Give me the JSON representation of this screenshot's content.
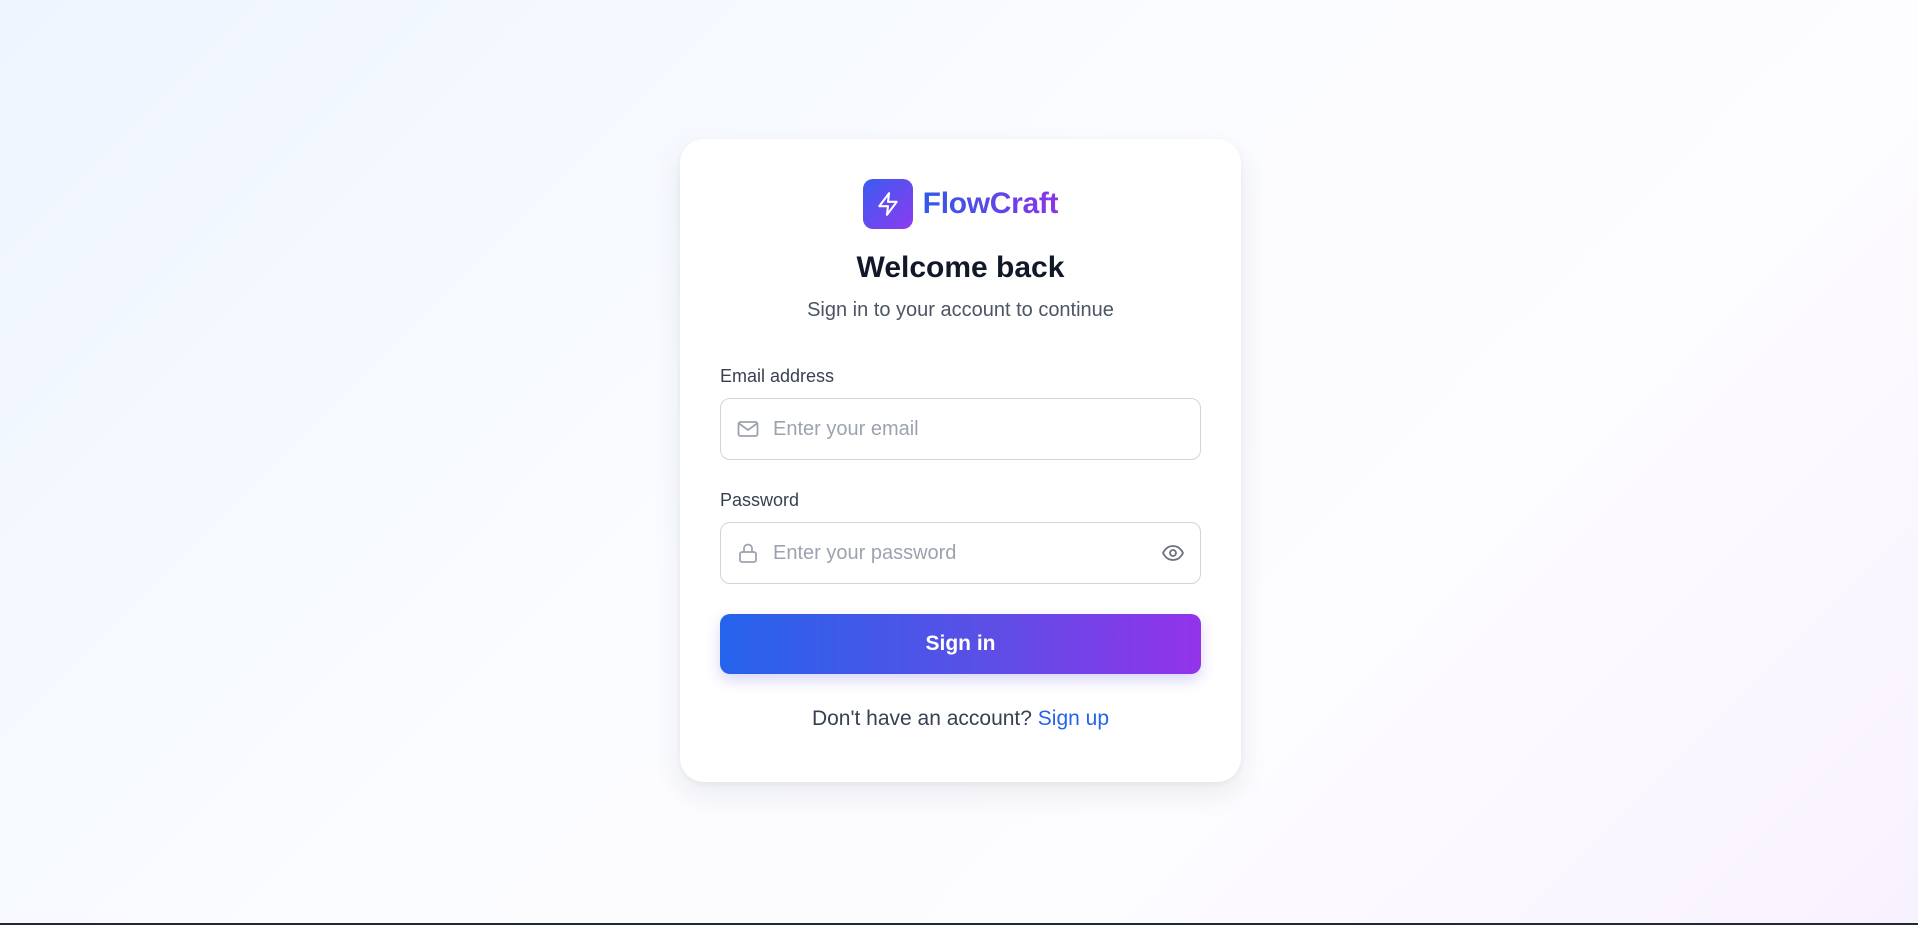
{
  "brand": {
    "name": "FlowCraft",
    "logo_icon": "lightning-bolt-icon",
    "gradient_start": "#3b5bf0",
    "gradient_end": "#8b3cf0"
  },
  "header": {
    "title": "Welcome back",
    "subtitle": "Sign in to your account to continue"
  },
  "form": {
    "email": {
      "label": "Email address",
      "placeholder": "Enter your email",
      "value": "",
      "icon": "mail-icon"
    },
    "password": {
      "label": "Password",
      "placeholder": "Enter your password",
      "value": "",
      "icon": "lock-icon",
      "toggle_icon": "eye-icon"
    },
    "submit_label": "Sign in"
  },
  "footer": {
    "prompt": "Don't have an account?",
    "link_label": "Sign up"
  },
  "colors": {
    "accent": "#2563eb",
    "accent_secondary": "#9333ea",
    "text_primary": "#111827",
    "text_muted": "#4b5563"
  }
}
